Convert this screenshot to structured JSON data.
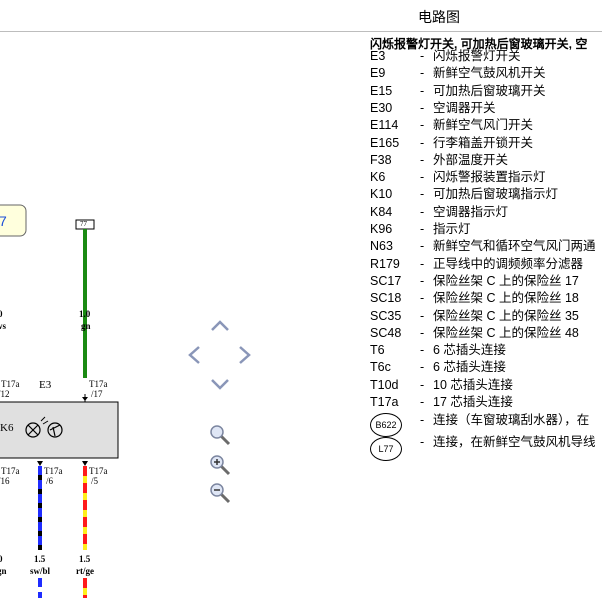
{
  "header": {
    "title": "电路图"
  },
  "legend": {
    "title": "闪烁报警灯开关, 可加热后窗玻璃开关, 空",
    "items": [
      {
        "code": "E3",
        "dash": "-",
        "desc": "闪烁报警灯开关"
      },
      {
        "code": "E9",
        "dash": "-",
        "desc": "新鲜空气鼓风机开关"
      },
      {
        "code": "E15",
        "dash": "-",
        "desc": "可加热后窗玻璃开关"
      },
      {
        "code": "E30",
        "dash": "-",
        "desc": "空调器开关"
      },
      {
        "code": "E114",
        "dash": "-",
        "desc": "新鲜空气风门开关"
      },
      {
        "code": "E165",
        "dash": "-",
        "desc": "行李箱盖开锁开关"
      },
      {
        "code": "F38",
        "dash": "-",
        "desc": "外部温度开关"
      },
      {
        "code": "K6",
        "dash": "-",
        "desc": "闪烁警报装置指示灯"
      },
      {
        "code": "K10",
        "dash": "-",
        "desc": "可加热后窗玻璃指示灯"
      },
      {
        "code": "K84",
        "dash": "-",
        "desc": "空调器指示灯"
      },
      {
        "code": "K96",
        "dash": "-",
        "desc": "指示灯"
      },
      {
        "code": "N63",
        "dash": "-",
        "desc": "新鲜空气和循环空气风门两通"
      },
      {
        "code": "R179",
        "dash": "-",
        "desc": "正导线中的调频频率分滤器"
      },
      {
        "code": "SC17",
        "dash": "-",
        "desc": "保险丝架 C 上的保险丝 17"
      },
      {
        "code": "SC18",
        "dash": "-",
        "desc": "保险丝架 C 上的保险丝 18"
      },
      {
        "code": "SC35",
        "dash": "-",
        "desc": "保险丝架 C 上的保险丝 35"
      },
      {
        "code": "SC48",
        "dash": "-",
        "desc": "保险丝架 C 上的保险丝 48"
      },
      {
        "code": "T6",
        "dash": "-",
        "desc": "6 芯插头连接"
      },
      {
        "code": "T6c",
        "dash": "-",
        "desc": "6 芯插头连接"
      },
      {
        "code": "T10d",
        "dash": "-",
        "desc": "10 芯插头连接"
      },
      {
        "code": "T17a",
        "dash": "-",
        "desc": "17 芯插头连接"
      }
    ],
    "connectors": [
      {
        "symbol": "B622",
        "dash": "-",
        "desc": "连接（车窗玻璃刮水器），在"
      },
      {
        "symbol": "L77",
        "dash": "-",
        "desc": "连接，在新鲜空气鼓风机导线"
      }
    ]
  },
  "diagram": {
    "left_box_label": "7",
    "terminal_77": "77",
    "wires": [
      {
        "size": "1.0",
        "color": "gn",
        "partial_size": "0",
        "partial_color": "ws"
      },
      {
        "size": "1.5",
        "color": "sw/bl"
      },
      {
        "size": "1.5",
        "color": "rt/ge"
      },
      {
        "partial_size": "0",
        "partial_color": "gn"
      }
    ],
    "component_code": "E3",
    "lamp_code": "K6",
    "pins": [
      {
        "connector": "T17a",
        "pin": "/12"
      },
      {
        "connector": "T17a",
        "pin": "/17"
      },
      {
        "connector": "T17a",
        "pin": "/16"
      },
      {
        "connector": "T17a",
        "pin": "/6"
      },
      {
        "connector": "T17a",
        "pin": "/5"
      }
    ],
    "wire_colors": {
      "green": "#1a8a12",
      "blue": "#1f2cff",
      "black": "#000000",
      "red": "#ff1a1a",
      "yellow": "#ffee1a"
    }
  },
  "nav": {
    "icons": [
      "pan-up-icon",
      "pan-left-icon",
      "pan-right-icon",
      "pan-down-icon",
      "zoom-reset-icon",
      "zoom-in-icon",
      "zoom-out-icon"
    ]
  }
}
